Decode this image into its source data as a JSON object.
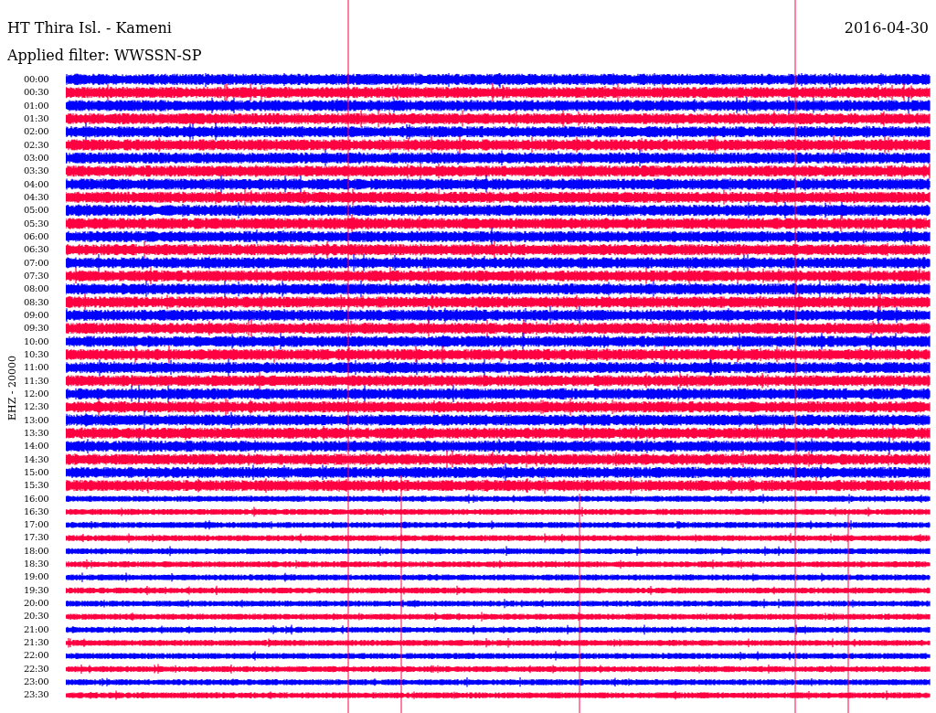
{
  "header": {
    "station": "HT Thira Isl. - Kameni",
    "date": "2016-04-30",
    "filter": "Applied filter: WWSSN-SP"
  },
  "axis_label": "EHZ - 20000",
  "traces": [
    {
      "time": "00:00",
      "color": "#0000ff"
    },
    {
      "time": "00:30",
      "color": "#ff0040"
    },
    {
      "time": "01:00",
      "color": "#0000ff"
    },
    {
      "time": "01:30",
      "color": "#ff0040"
    },
    {
      "time": "02:00",
      "color": "#0000ff"
    },
    {
      "time": "02:30",
      "color": "#ff0040"
    },
    {
      "time": "03:00",
      "color": "#0000ff"
    },
    {
      "time": "03:30",
      "color": "#ff0040"
    },
    {
      "time": "04:00",
      "color": "#0000ff"
    },
    {
      "time": "04:30",
      "color": "#ff0040"
    },
    {
      "time": "05:00",
      "color": "#0000ff"
    },
    {
      "time": "05:30",
      "color": "#ff0040"
    },
    {
      "time": "06:00",
      "color": "#0000ff"
    },
    {
      "time": "06:30",
      "color": "#ff0040"
    },
    {
      "time": "07:00",
      "color": "#0000ff"
    },
    {
      "time": "07:30",
      "color": "#ff0040"
    },
    {
      "time": "08:00",
      "color": "#0000ff"
    },
    {
      "time": "08:30",
      "color": "#ff0040"
    },
    {
      "time": "09:00",
      "color": "#0000ff"
    },
    {
      "time": "09:30",
      "color": "#ff0040"
    },
    {
      "time": "10:00",
      "color": "#0000ff"
    },
    {
      "time": "10:30",
      "color": "#ff0040"
    },
    {
      "time": "11:00",
      "color": "#0000ff"
    },
    {
      "time": "11:30",
      "color": "#ff0040"
    },
    {
      "time": "12:00",
      "color": "#0000ff"
    },
    {
      "time": "12:30",
      "color": "#ff0040"
    },
    {
      "time": "13:00",
      "color": "#0000ff"
    },
    {
      "time": "13:30",
      "color": "#ff0040"
    },
    {
      "time": "14:00",
      "color": "#0000ff"
    },
    {
      "time": "14:30",
      "color": "#ff0040"
    },
    {
      "time": "15:00",
      "color": "#0000ff"
    },
    {
      "time": "15:30",
      "color": "#ff0040"
    },
    {
      "time": "16:00",
      "color": "#0000ff"
    },
    {
      "time": "16:30",
      "color": "#ff0040"
    },
    {
      "time": "17:00",
      "color": "#0000ff"
    },
    {
      "time": "17:30",
      "color": "#ff0040"
    },
    {
      "time": "18:00",
      "color": "#0000ff"
    },
    {
      "time": "18:30",
      "color": "#ff0040"
    },
    {
      "time": "19:00",
      "color": "#0000ff"
    },
    {
      "time": "19:30",
      "color": "#ff0040"
    },
    {
      "time": "20:00",
      "color": "#0000ff"
    },
    {
      "time": "20:30",
      "color": "#ff0040"
    },
    {
      "time": "21:00",
      "color": "#0000ff"
    },
    {
      "time": "21:30",
      "color": "#ff0040"
    },
    {
      "time": "22:00",
      "color": "#0000ff"
    },
    {
      "time": "22:30",
      "color": "#ff0040"
    },
    {
      "time": "23:00",
      "color": "#0000ff"
    },
    {
      "time": "23:30",
      "color": "#ff0040"
    }
  ]
}
